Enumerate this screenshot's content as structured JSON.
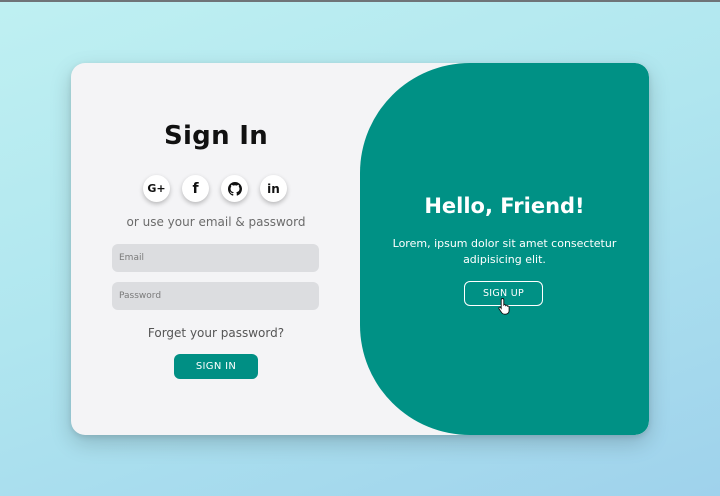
{
  "signin": {
    "title": "Sign In",
    "socials": [
      {
        "label": "G+",
        "icon": "google-plus-icon"
      },
      {
        "label": "f",
        "icon": "facebook-icon"
      },
      {
        "label": "",
        "icon": "github-icon"
      },
      {
        "label": "in",
        "icon": "linkedin-icon"
      }
    ],
    "or_text": "or use your email & password",
    "email_placeholder": "Email",
    "password_placeholder": "Password",
    "forgot_text": "Forget your password?",
    "button_label": "SIGN IN"
  },
  "signup": {
    "title": "Hello, Friend!",
    "text": "Lorem, ipsum dolor sit amet consectetur adipisicing elit.",
    "button_label": "SIGN UP"
  },
  "colors": {
    "accent": "#009185",
    "card_bg": "#f4f4f6"
  }
}
